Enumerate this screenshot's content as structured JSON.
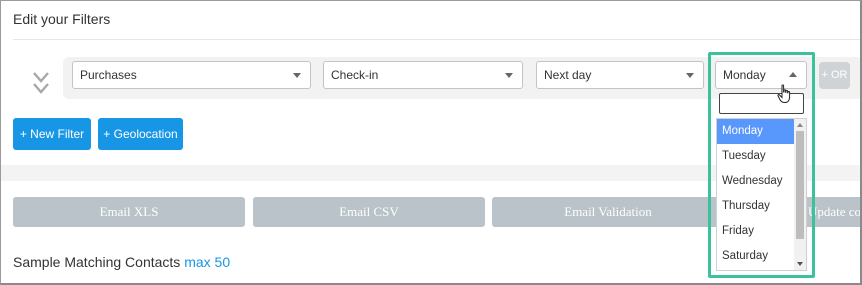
{
  "panel": {
    "title": "Edit your Filters"
  },
  "filter": {
    "field": "Purchases",
    "event": "Check-in",
    "timing": "Next day",
    "day": "Monday",
    "or_label": "+ OR"
  },
  "actions": {
    "new_filter": "+ New Filter",
    "geolocation": "+ Geolocation"
  },
  "email_buttons": {
    "xls": "Email XLS",
    "csv": "Email CSV",
    "validation": "Email Validation",
    "update": "Update con"
  },
  "sample": {
    "label": "Sample Matching Contacts",
    "max": "max 50"
  },
  "dropdown": {
    "search_value": "",
    "options": [
      "Monday",
      "Tuesday",
      "Wednesday",
      "Thursday",
      "Friday",
      "Saturday"
    ],
    "selected_index": 0
  },
  "colors": {
    "accent_blue": "#1796e6",
    "selected_option": "#5897fb",
    "highlight_frame": "#3cc29a",
    "disabled_button": "#b9c3c9"
  }
}
